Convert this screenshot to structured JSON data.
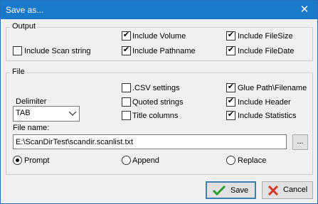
{
  "window": {
    "title": "Save as...",
    "close_glyph": "✕"
  },
  "output": {
    "legend": "Output",
    "include_volume": {
      "label": "Include Volume",
      "checked": true
    },
    "include_filesize": {
      "label": "Include FileSize",
      "checked": true
    },
    "include_scan_string": {
      "label": "Include Scan string",
      "checked": false
    },
    "include_pathname": {
      "label": "Include Pathname",
      "checked": true
    },
    "include_filedate": {
      "label": "Include FileDate",
      "checked": true
    }
  },
  "file": {
    "legend": "File",
    "csv_settings": {
      "label": ".CSV settings",
      "checked": false
    },
    "glue_path": {
      "label": "Glue Path\\Filename",
      "checked": true
    },
    "delimiter_label": "Delimiter",
    "quoted_strings": {
      "label": "Quoted strings",
      "checked": false
    },
    "include_header": {
      "label": "Include Header",
      "checked": true
    },
    "delimiter_value": "TAB",
    "title_columns": {
      "label": "Title columns",
      "checked": false
    },
    "include_statistics": {
      "label": "Include Statistics",
      "checked": true
    },
    "filename_label": "File name:",
    "filename_value": "E:\\ScanDirTest\\scandir.scanlist.txt",
    "browse_label": "...",
    "mode": {
      "prompt": {
        "label": "Prompt",
        "selected": true
      },
      "append": {
        "label": "Append",
        "selected": false
      },
      "replace": {
        "label": "Replace",
        "selected": false
      }
    }
  },
  "buttons": {
    "save_label": "Save",
    "cancel_label": "Cancel"
  },
  "icons": {
    "check_color": "#2e9e2e",
    "cancel_color": "#d23a2a"
  }
}
